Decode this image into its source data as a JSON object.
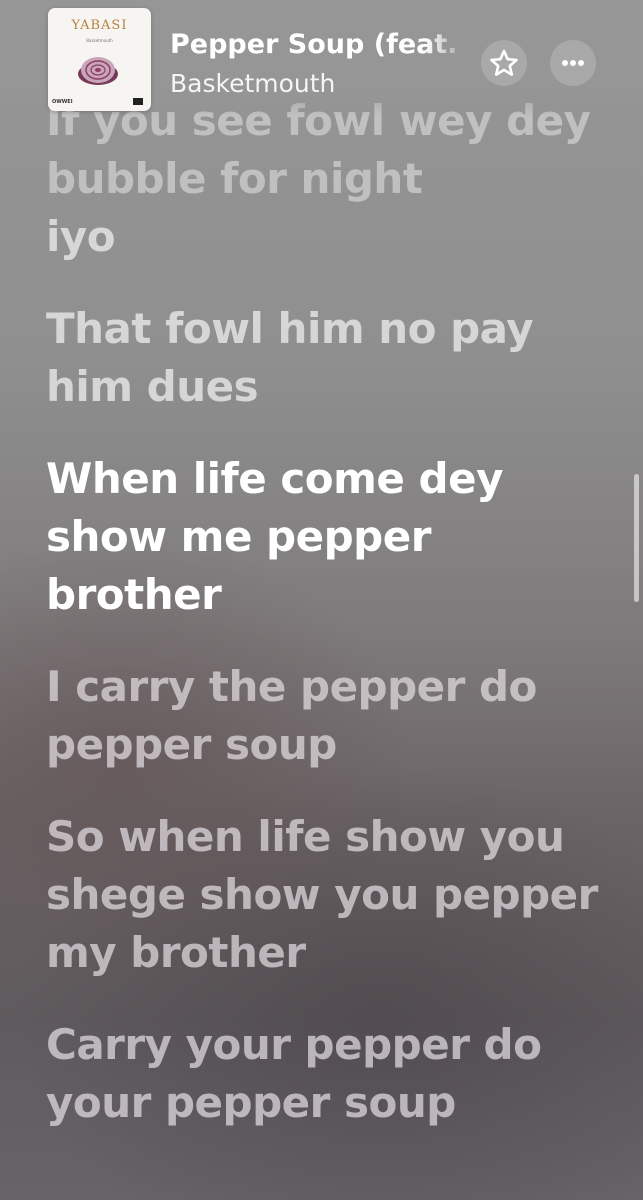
{
  "header": {
    "song_title": "Pepper Soup (feat.",
    "artist": "Basketmouth",
    "artwork": {
      "title": "YABASI",
      "subtitle": "Basketmouth",
      "footer": "OWWEI"
    },
    "favorite_icon": "star-icon",
    "more_icon": "ellipsis-icon"
  },
  "lyrics": [
    {
      "text": "If you see fowl wey dey bubble for night",
      "state": "past"
    },
    {
      "text": "iyo",
      "state": "past"
    },
    {
      "text": "That fowl him no pay him dues",
      "state": "past"
    },
    {
      "text": "When life come dey show me pepper brother",
      "state": "active"
    },
    {
      "text": "I carry the pepper do pepper soup",
      "state": "upcoming"
    },
    {
      "text": "So when life show you shege show you pepper my brother",
      "state": "upcoming"
    },
    {
      "text": "Carry your pepper do your pepper soup",
      "state": "upcoming"
    }
  ],
  "colors": {
    "active_text": "#ffffff",
    "artwork_title": "#b9823f"
  }
}
